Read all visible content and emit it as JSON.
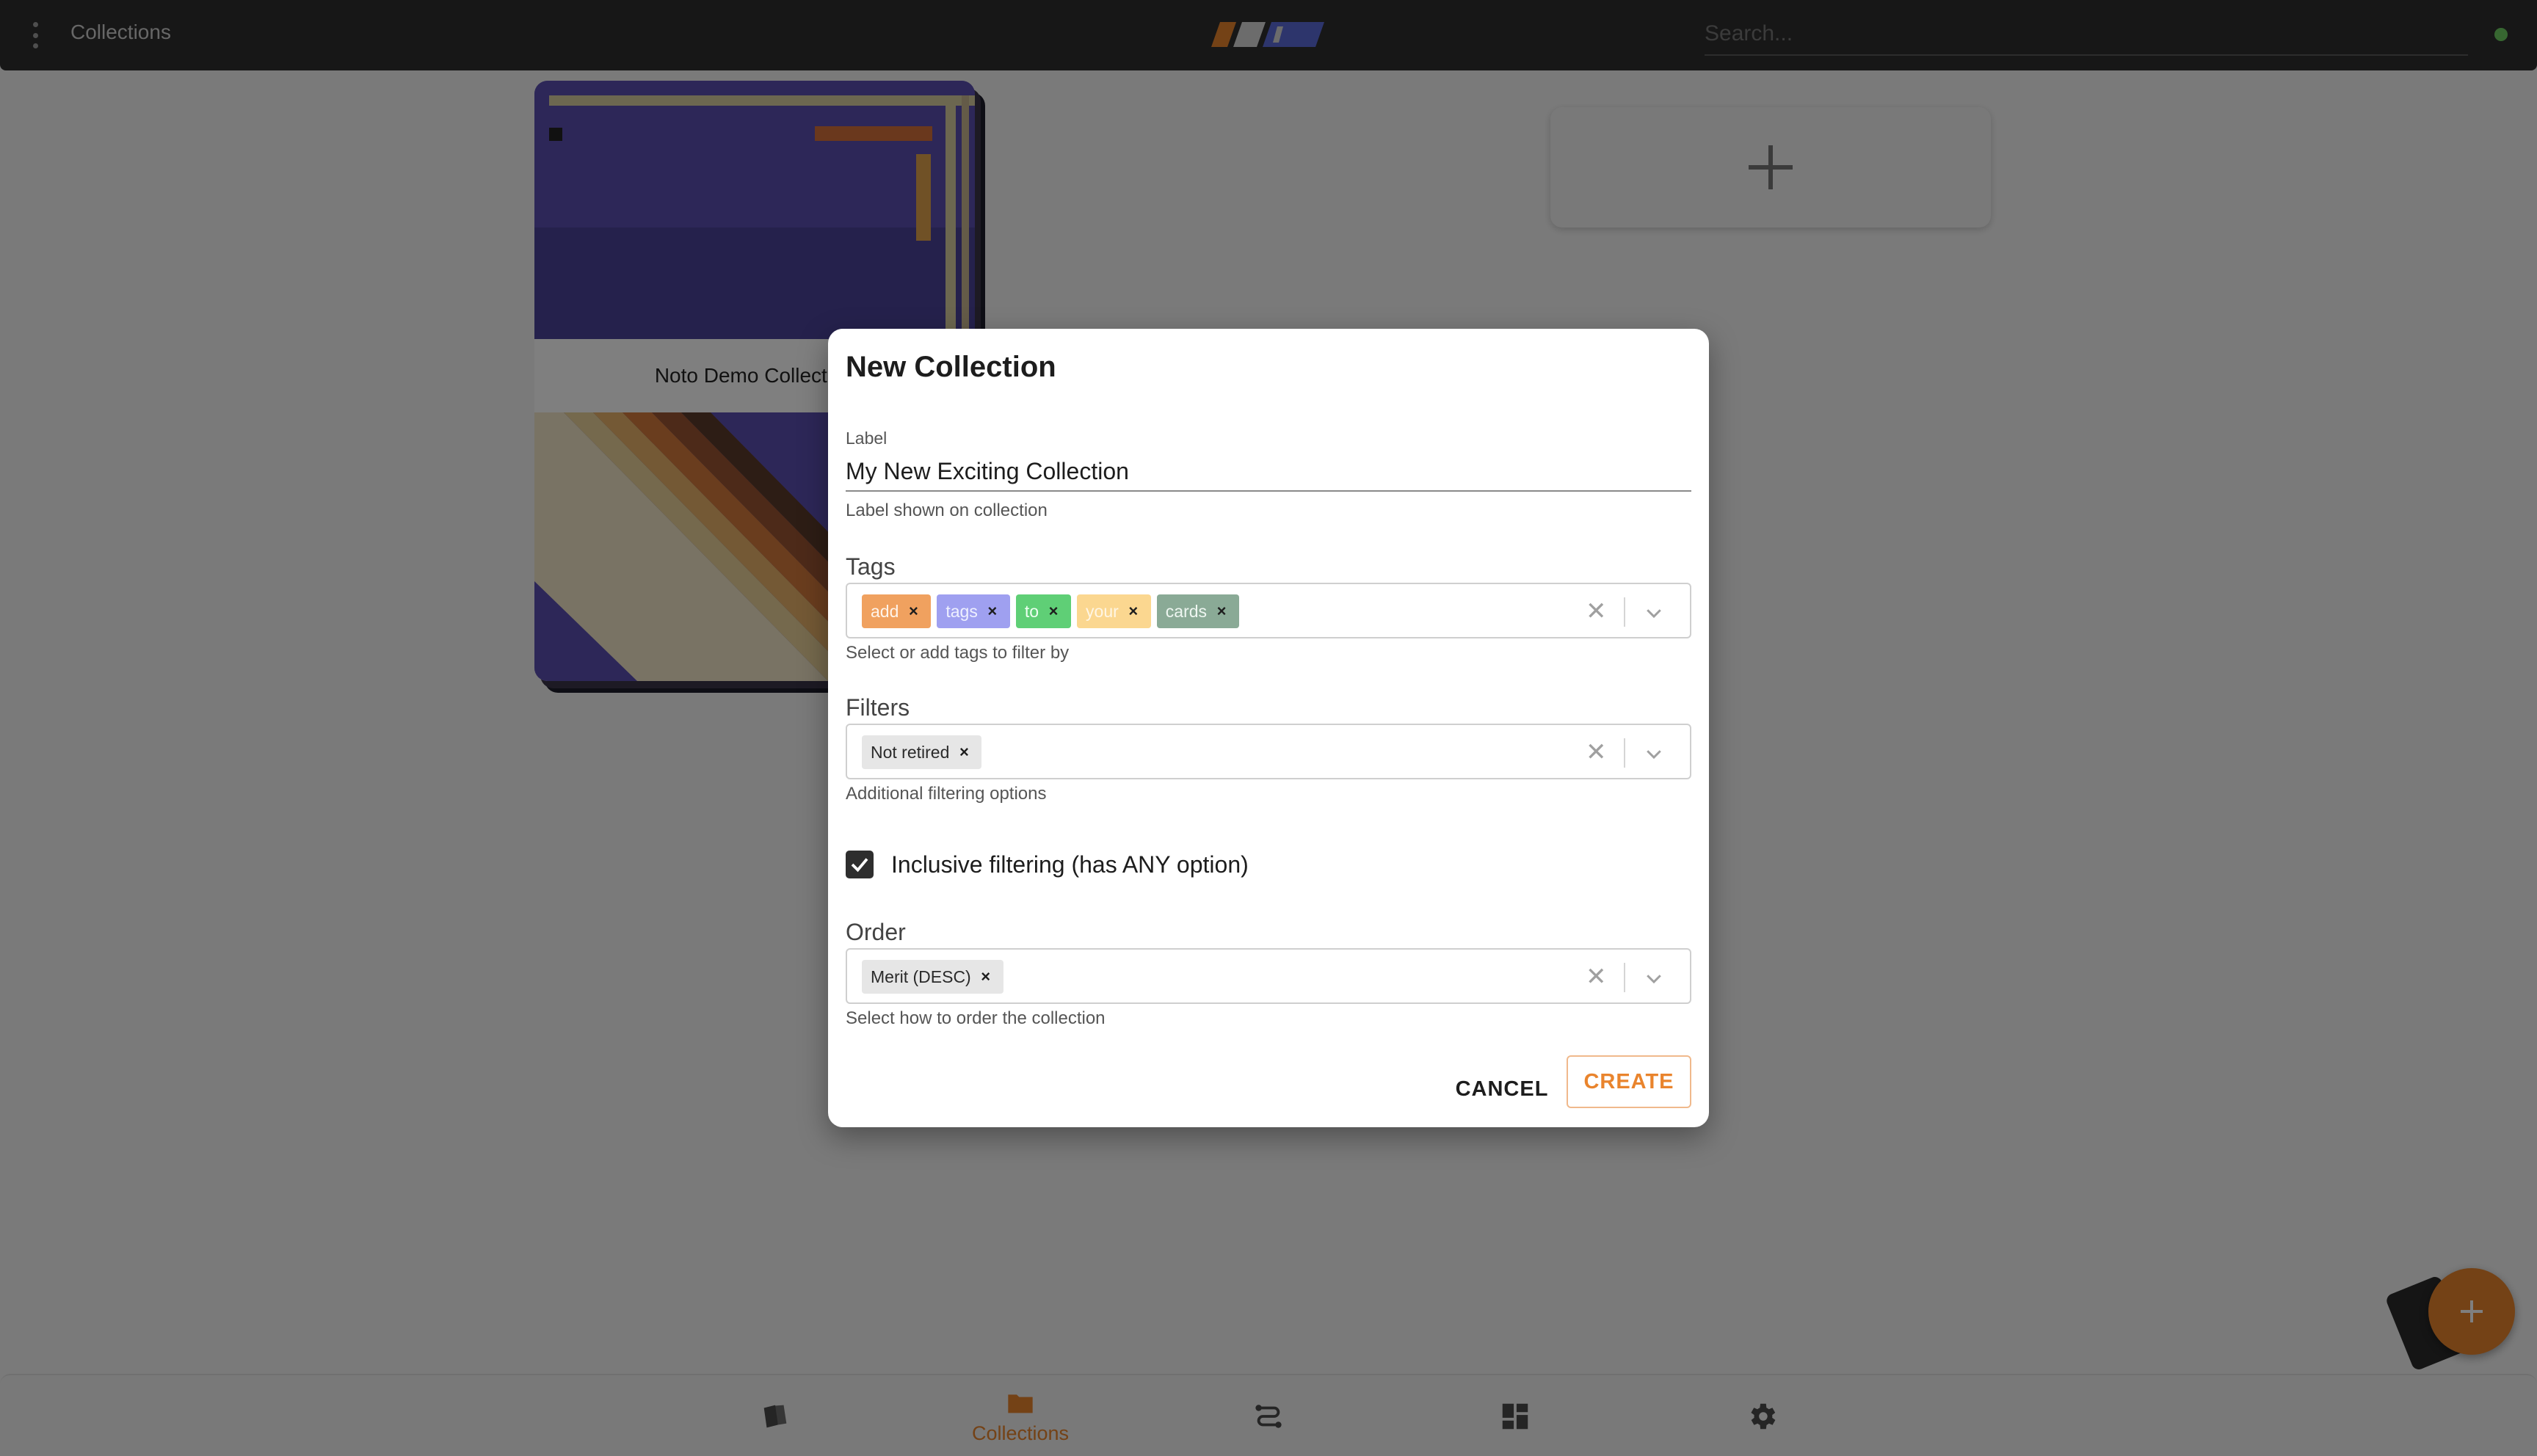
{
  "topbar": {
    "title": "Collections",
    "search_placeholder": "Search..."
  },
  "background": {
    "collection_card_label": "Noto Demo Collection"
  },
  "bottom_nav": {
    "items": [
      {
        "icon": "cards-icon"
      },
      {
        "icon": "folder-icon",
        "label": "Collections",
        "active": true
      },
      {
        "icon": "route-icon"
      },
      {
        "icon": "dashboard-icon"
      },
      {
        "icon": "gear-icon"
      }
    ]
  },
  "dialog": {
    "title": "New Collection",
    "label_field": {
      "label": "Label",
      "value": "My New Exciting Collection",
      "helper": "Label shown on collection"
    },
    "tags_field": {
      "label": "Tags",
      "chips": [
        {
          "text": "add",
          "bg": "#f0a15f",
          "fg": "#fff4ea"
        },
        {
          "text": "tags",
          "bg": "#9fa0f0",
          "fg": "#eef0ff"
        },
        {
          "text": "to",
          "bg": "#5fcf76",
          "fg": "#eefff2"
        },
        {
          "text": "your",
          "bg": "#fbd790",
          "fg": "#fff6e4"
        },
        {
          "text": "cards",
          "bg": "#8aaa96",
          "fg": "#eef6f1"
        }
      ],
      "helper": "Select or add tags to filter by"
    },
    "filters_field": {
      "label": "Filters",
      "chips": [
        {
          "text": "Not retired",
          "bg": "#e6e6e6",
          "fg": "#2a2a2a"
        }
      ],
      "helper": "Additional filtering options"
    },
    "inclusive_checkbox": {
      "label": "Inclusive filtering (has ANY option)",
      "checked": true
    },
    "order_field": {
      "label": "Order",
      "chips": [
        {
          "text": "Merit (DESC)",
          "bg": "#e6e6e6",
          "fg": "#2a2a2a"
        }
      ],
      "helper": "Select how to order the collection"
    },
    "cancel_label": "CANCEL",
    "create_label": "CREATE"
  },
  "colors": {
    "accent": "#e9842d",
    "topbar": "#2e2e2e",
    "status_online": "#6fcf63"
  }
}
